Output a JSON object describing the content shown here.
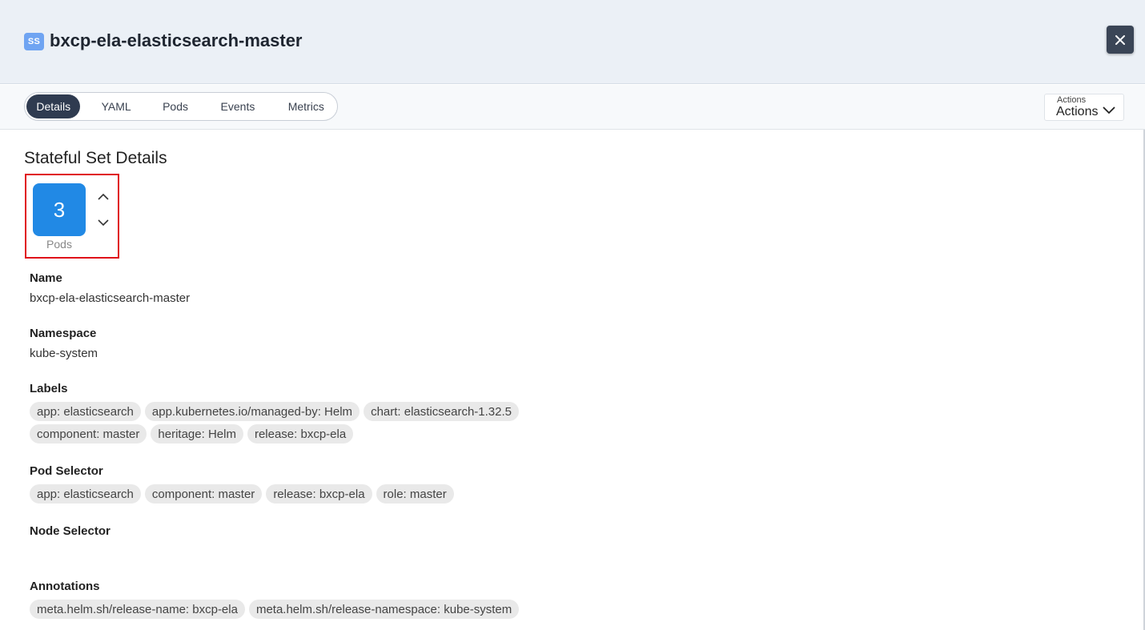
{
  "header": {
    "kind_badge": "SS",
    "title": "bxcp-ela-elasticsearch-master"
  },
  "tabs": [
    {
      "label": "Details",
      "active": true
    },
    {
      "label": "YAML",
      "active": false
    },
    {
      "label": "Pods",
      "active": false
    },
    {
      "label": "Events",
      "active": false
    },
    {
      "label": "Metrics",
      "active": false
    }
  ],
  "actions": {
    "small_label": "Actions",
    "label": "Actions"
  },
  "details": {
    "section_title": "Stateful Set Details",
    "pods": {
      "count": "3",
      "label": "Pods"
    },
    "name": {
      "label": "Name",
      "value": "bxcp-ela-elasticsearch-master"
    },
    "namespace": {
      "label": "Namespace",
      "value": "kube-system"
    },
    "labels": {
      "label": "Labels",
      "rows": [
        [
          "app: elasticsearch",
          "app.kubernetes.io/managed-by: Helm",
          "chart: elasticsearch-1.32.5"
        ],
        [
          "component: master",
          "heritage: Helm",
          "release: bxcp-ela"
        ]
      ]
    },
    "pod_selector": {
      "label": "Pod Selector",
      "items": [
        "app: elasticsearch",
        "component: master",
        "release: bxcp-ela",
        "role: master"
      ]
    },
    "node_selector": {
      "label": "Node Selector"
    },
    "annotations": {
      "label": "Annotations",
      "items": [
        "meta.helm.sh/release-name: bxcp-ela",
        "meta.helm.sh/release-namespace: kube-system"
      ]
    }
  },
  "colors": {
    "header_bg": "#ebf0f6",
    "badge": "#6fa4f2",
    "active_tab": "#2f3b50",
    "pod_count_bg": "#2189e5",
    "highlight_border": "#e0101a"
  }
}
